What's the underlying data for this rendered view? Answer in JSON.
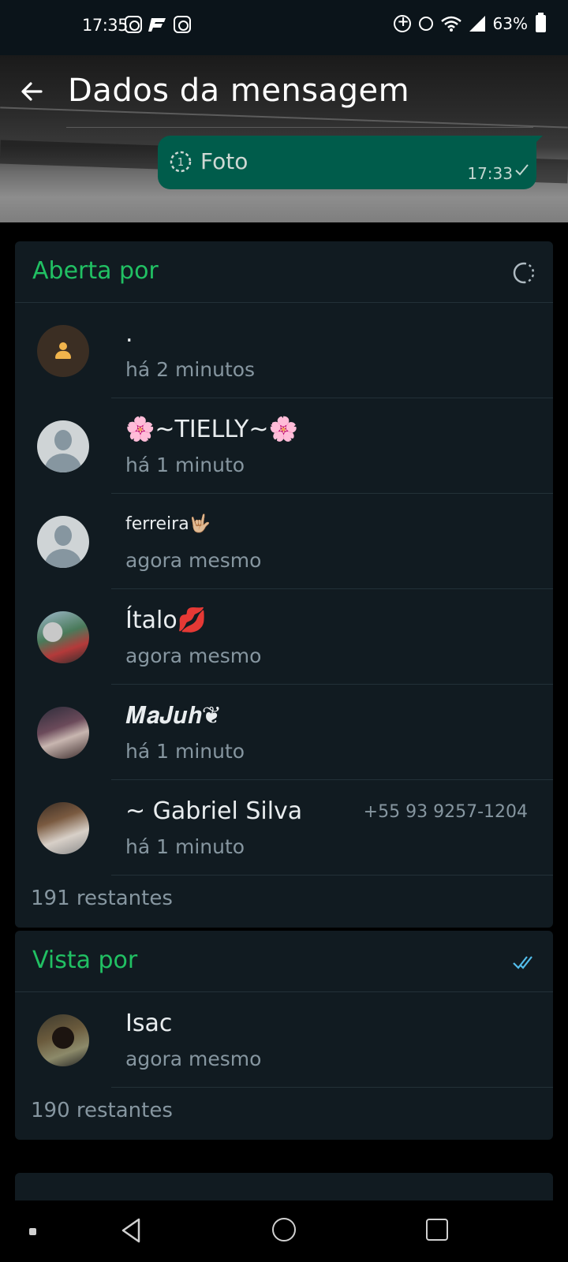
{
  "status_bar": {
    "time": "17:35",
    "battery": "63%",
    "left_icons": [
      "instagram-icon",
      "flash-app-icon",
      "instagram-icon"
    ],
    "right_icons": [
      "data-saver-icon",
      "alarm-icon",
      "wifi-icon",
      "signal-icon",
      "battery-icon"
    ]
  },
  "header": {
    "title": "Dados da mensagem",
    "back_icon": "arrow-left-icon"
  },
  "message": {
    "text": "Foto",
    "time": "17:33",
    "view_once_label": "1",
    "bubble_color": "#005c4b"
  },
  "opened_by": {
    "title": "Aberta por",
    "icon": "view-once-opened-icon",
    "accent_color": "#21c063",
    "contacts": [
      {
        "name": ".",
        "status": "há 2 minutos",
        "phone": ""
      },
      {
        "name": "🌸~TIELLY~🌸",
        "status": "há 1 minuto",
        "phone": ""
      },
      {
        "name": "ferreira🤟🏼",
        "status": "agora mesmo",
        "phone": ""
      },
      {
        "name": "Ítalo💋",
        "status": "agora mesmo",
        "phone": ""
      },
      {
        "name": "𝑴𝒂𝑱𝒖𝒉❦",
        "status": "há 1 minuto",
        "phone": ""
      },
      {
        "name": "~ Gabriel Silva",
        "status": "há 1 minuto",
        "phone": "+55 93 9257-1204"
      }
    ],
    "remaining": "191 restantes"
  },
  "seen_by": {
    "title": "Vista por",
    "icon": "double-check-blue-icon",
    "check_color": "#53bdeb",
    "contacts": [
      {
        "name": "Isac",
        "status": "agora mesmo"
      }
    ],
    "remaining": "190 restantes"
  },
  "nav_bar": {
    "icons": [
      "back-triangle-icon",
      "home-circle-icon",
      "recents-square-icon"
    ]
  }
}
